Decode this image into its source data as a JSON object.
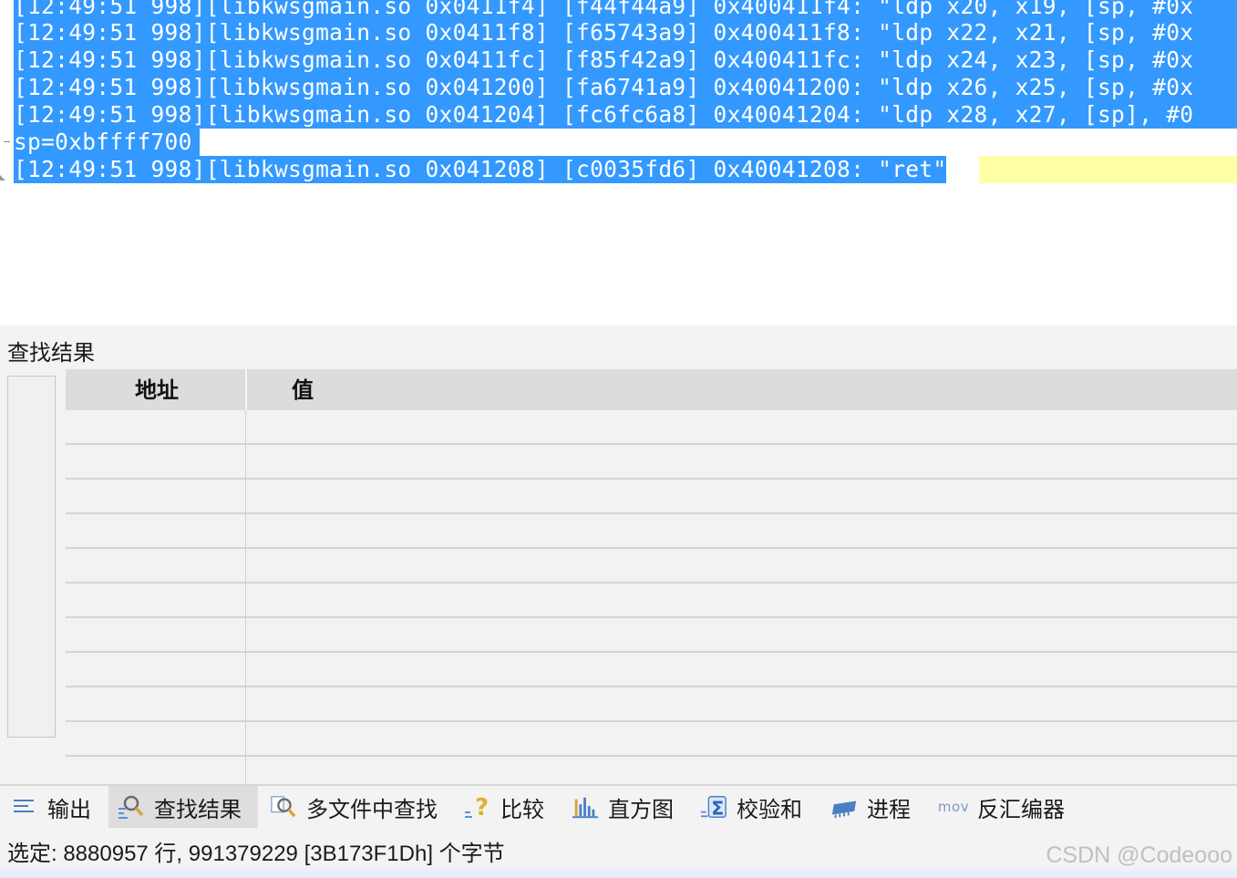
{
  "editor": {
    "lines": [
      "[12:49:51 998][libkwsgmain.so 0x0411f4] [f44f44a9] 0x400411f4: \"ldp x20, x19, [sp, #0x",
      "[12:49:51 998][libkwsgmain.so 0x0411f8] [f65743a9] 0x400411f8: \"ldp x22, x21, [sp, #0x",
      "[12:49:51 998][libkwsgmain.so 0x0411fc] [f85f42a9] 0x400411fc: \"ldp x24, x23, [sp, #0x",
      "[12:49:51 998][libkwsgmain.so 0x041200] [fa6741a9] 0x40041200: \"ldp x26, x25, [sp, #0x",
      "[12:49:51 998][libkwsgmain.so 0x041204] [fc6fc6a8] 0x40041204: \"ldp x28, x27, [sp], #0",
      "sp=0xbffff700",
      "[12:49:51 998][libkwsgmain.so 0x041208] [c0035fd6] 0x40041208: \"ret\""
    ],
    "selection_color": "#3399ff",
    "current_line_color": "#ffffa5"
  },
  "find_panel": {
    "title": "查找结果",
    "columns": [
      "地址",
      "值"
    ]
  },
  "tabs": [
    {
      "label": "输出",
      "icon": "output-icon"
    },
    {
      "label": "查找结果",
      "icon": "search-icon"
    },
    {
      "label": "多文件中查找",
      "icon": "multi-file-search-icon"
    },
    {
      "label": "比较",
      "icon": "compare-icon"
    },
    {
      "label": "直方图",
      "icon": "histogram-icon"
    },
    {
      "label": "校验和",
      "icon": "checksum-icon"
    },
    {
      "label": "进程",
      "icon": "process-icon"
    },
    {
      "label": "反汇编器",
      "icon": "disassembler-icon"
    }
  ],
  "disassembler_icon_text": "mov",
  "status": {
    "text": "选定: 8880957 行, 991379229 [3B173F1Dh] 个字节"
  },
  "watermark": "CSDN @Codeooo"
}
